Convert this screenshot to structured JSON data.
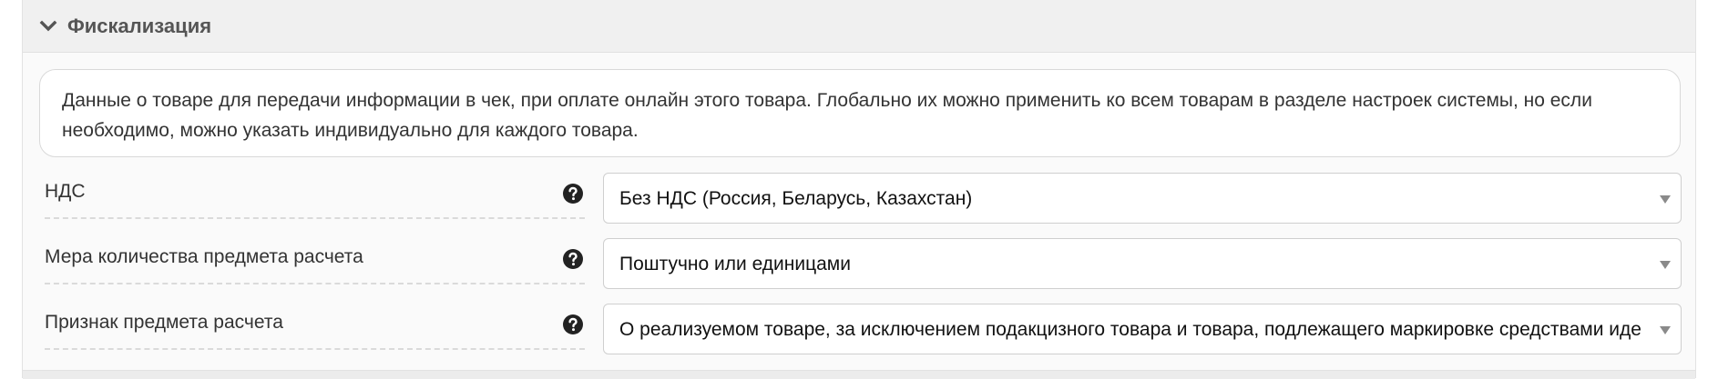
{
  "section": {
    "title": "Фискализация",
    "expanded_icon": "chevron-down-icon"
  },
  "info": {
    "text": "Данные о товаре для передачи информации в чек, при оплате онлайн этого товара. Глобально их можно применить ко всем товарам в разделе настроек системы, но если необходимо, можно указать индивидуально для каждого товара."
  },
  "fields": [
    {
      "label": "НДС",
      "help_icon": "question-circle-icon",
      "value": "Без НДС (Россия, Беларусь, Казахстан)"
    },
    {
      "label": "Мера количества предмета расчета",
      "help_icon": "question-circle-icon",
      "value": "Поштучно или единицами"
    },
    {
      "label": "Признак предмета расчета",
      "help_icon": "question-circle-icon",
      "value": "О реализуемом товаре, за исключением подакцизного товара и товара, подлежащего маркировке средствами идентификации"
    }
  ],
  "colors": {
    "header_bg": "#f0f0f0",
    "panel_bg": "#fafafa",
    "text": "#333333",
    "title_text": "#555555"
  }
}
